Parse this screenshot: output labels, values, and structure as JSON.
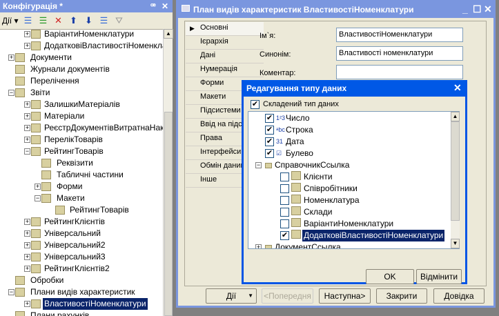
{
  "config_panel": {
    "title": "Конфігурація *",
    "pin": "ꟹ",
    "close": "✕",
    "actions_label": "Дії",
    "tree": [
      {
        "label": "ВаріантиНоменклатури",
        "level": 2,
        "exp": "+"
      },
      {
        "label": "ДодатковіВластивостіНоменклатури",
        "level": 2,
        "exp": "+"
      },
      {
        "label": "Документи",
        "level": 1,
        "exp": "+"
      },
      {
        "label": "Журнали документів",
        "level": 1,
        "exp": ""
      },
      {
        "label": "Перелічення",
        "level": 1,
        "exp": ""
      },
      {
        "label": "Звіти",
        "level": 1,
        "exp": "-"
      },
      {
        "label": "ЗалишкиМатеріалів",
        "level": 2,
        "exp": "+"
      },
      {
        "label": "Матеріали",
        "level": 2,
        "exp": "+"
      },
      {
        "label": "РеєстрДокументівВитратнаНакладна",
        "level": 2,
        "exp": "+"
      },
      {
        "label": "ПерелікТоварів",
        "level": 2,
        "exp": "+"
      },
      {
        "label": "РейтингТоварів",
        "level": 2,
        "exp": "-"
      },
      {
        "label": "Реквізити",
        "level": 3,
        "exp": ""
      },
      {
        "label": "Табличні частини",
        "level": 3,
        "exp": ""
      },
      {
        "label": "Форми",
        "level": 3,
        "exp": "+"
      },
      {
        "label": "Макети",
        "level": 3,
        "exp": "-"
      },
      {
        "label": "РейтингТоварів",
        "level": 4,
        "exp": ""
      },
      {
        "label": "РейтингКлієнтів",
        "level": 2,
        "exp": "+"
      },
      {
        "label": "Універсальний",
        "level": 2,
        "exp": "+"
      },
      {
        "label": "Універсальний2",
        "level": 2,
        "exp": "+"
      },
      {
        "label": "Універсальний3",
        "level": 2,
        "exp": "+"
      },
      {
        "label": "РейтингКлієнтів2",
        "level": 2,
        "exp": "+"
      },
      {
        "label": "Обробки",
        "level": 1,
        "exp": ""
      },
      {
        "label": "Плани видів характеристик",
        "level": 1,
        "exp": "-"
      },
      {
        "label": "ВластивостіНоменклатури",
        "level": 2,
        "exp": "+",
        "selected": true
      },
      {
        "label": "Плани рахунків",
        "level": 1,
        "exp": ""
      }
    ]
  },
  "window": {
    "title": "План видів характеристик ВластивостіНоменклатури",
    "tabs": [
      "Основні",
      "Ієрархія",
      "Дані",
      "Нумерація",
      "Форми",
      "Макети",
      "Підсистеми",
      "Ввід на підставі",
      "Права",
      "Інтерфейси",
      "Обмін даними",
      "Інше"
    ],
    "active_tab": "Основні",
    "name_label": "Ім`я:",
    "name_value": "ВластивостіНоменклатури",
    "synonym_label": "Синонім:",
    "synonym_value": "Властивості номенклатури",
    "comment_label": "Коментар:",
    "comment_value": "",
    "buttons": {
      "actions": "Дії",
      "prev": "<Попередня",
      "next": "Наступна>",
      "close": "Закрити",
      "help": "Довідка"
    }
  },
  "dialog": {
    "title": "Редагування типу даних",
    "composite_label": "Складений тип даних",
    "composite_checked": true,
    "types": [
      {
        "label": "Число",
        "checked": true,
        "level": 1,
        "icon": "1²3"
      },
      {
        "label": "Строка",
        "checked": true,
        "level": 1,
        "icon": "ᵃbc"
      },
      {
        "label": "Дата",
        "checked": true,
        "level": 1,
        "icon": "31"
      },
      {
        "label": "Булево",
        "checked": true,
        "level": 1,
        "icon": "☑"
      },
      {
        "label": "СправочникСсылка",
        "group": true,
        "level": 0
      },
      {
        "label": "Клієнти",
        "checked": false,
        "level": 2
      },
      {
        "label": "Співробітники",
        "checked": false,
        "level": 2
      },
      {
        "label": "Номенклатура",
        "checked": false,
        "level": 2
      },
      {
        "label": "Склади",
        "checked": false,
        "level": 2
      },
      {
        "label": "ВаріантиНоменклатури",
        "checked": false,
        "level": 2
      },
      {
        "label": "ДодатковіВластивостіНоменклатури",
        "checked": true,
        "level": 2,
        "selected": true
      },
      {
        "label": "ДокументСсылка",
        "group": true,
        "level": 0
      }
    ],
    "ok": "OK",
    "cancel": "Відмінити"
  }
}
